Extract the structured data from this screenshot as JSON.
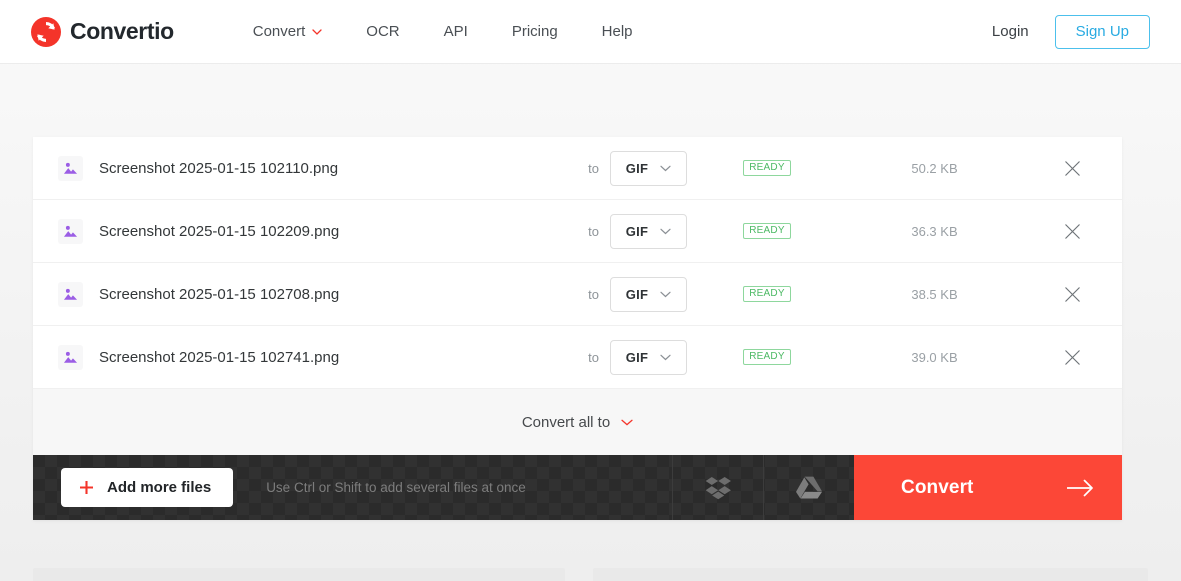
{
  "header": {
    "logo_icon": "convertio-refresh-circle-icon",
    "brand": "Convertio",
    "nav": [
      {
        "label": "Convert",
        "has_caret": true,
        "caret_icon": "chevron-down-icon"
      },
      {
        "label": "OCR",
        "has_caret": false
      },
      {
        "label": "API",
        "has_caret": false
      },
      {
        "label": "Pricing",
        "has_caret": false
      },
      {
        "label": "Help",
        "has_caret": false
      }
    ],
    "login_label": "Login",
    "signup_label": "Sign Up",
    "accent_blue": "#29abe2",
    "accent_red": "#fc4737"
  },
  "files": {
    "to_label": "to",
    "rows": [
      {
        "icon": "image-file-icon",
        "name": "Screenshot 2025-01-15 102110.png",
        "format": "GIF",
        "status": "READY",
        "size": "50.2 KB",
        "remove_icon": "close-x-icon"
      },
      {
        "icon": "image-file-icon",
        "name": "Screenshot 2025-01-15 102209.png",
        "format": "GIF",
        "status": "READY",
        "size": "36.3 KB",
        "remove_icon": "close-x-icon"
      },
      {
        "icon": "image-file-icon",
        "name": "Screenshot 2025-01-15 102708.png",
        "format": "GIF",
        "status": "READY",
        "size": "38.5 KB",
        "remove_icon": "close-x-icon"
      },
      {
        "icon": "image-file-icon",
        "name": "Screenshot 2025-01-15 102741.png",
        "format": "GIF",
        "status": "READY",
        "size": "39.0 KB",
        "remove_icon": "close-x-icon"
      }
    ],
    "convert_all_label": "Convert all to",
    "convert_all_caret_icon": "chevron-down-icon",
    "status_color": "#4cb964"
  },
  "action_bar": {
    "add_files_label": "Add more files",
    "add_files_icon": "plus-icon",
    "hint": "Use Ctrl or Shift to add several files at once",
    "dropbox_icon": "dropbox-icon",
    "gdrive_icon": "google-drive-icon",
    "convert_label": "Convert",
    "convert_arrow_icon": "arrow-right-icon",
    "convert_button_color": "#fc4737"
  }
}
